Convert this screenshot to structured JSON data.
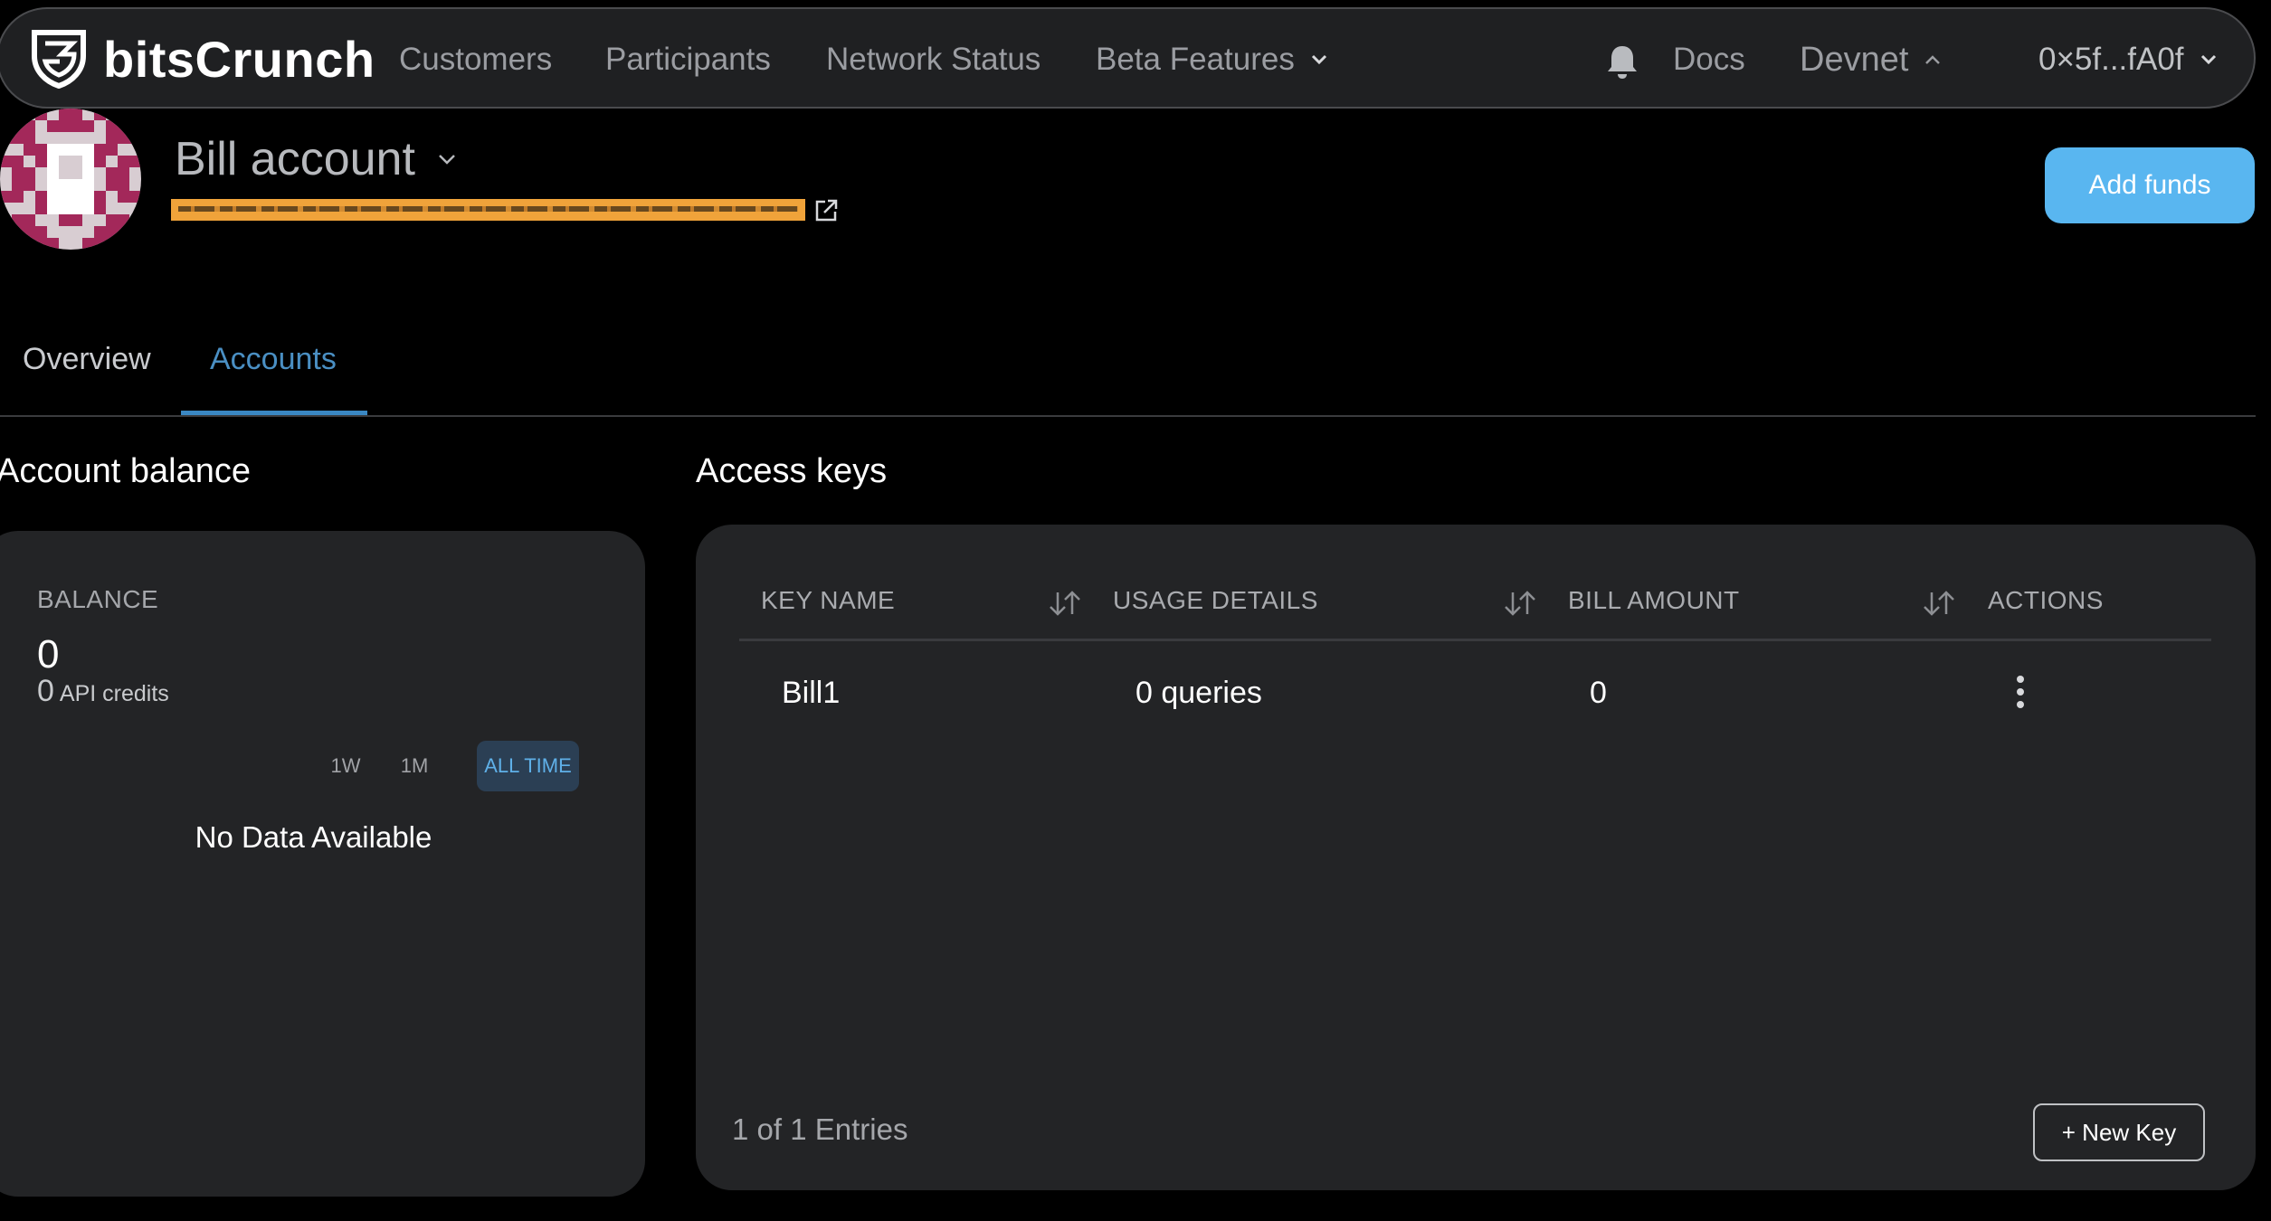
{
  "nav": {
    "brand": "bitsCrunch",
    "items": [
      {
        "label": "Customers"
      },
      {
        "label": "Participants"
      },
      {
        "label": "Network Status"
      },
      {
        "label": "Beta Features"
      }
    ],
    "docs": "Docs",
    "network": "Devnet",
    "wallet": "0×5f...fA0f"
  },
  "account": {
    "title": "Bill account",
    "add_funds": "Add funds"
  },
  "tabs": [
    {
      "label": "Overview",
      "active": false
    },
    {
      "label": "Accounts",
      "active": true
    }
  ],
  "balance": {
    "section_title": "Account balance",
    "label": "BALANCE",
    "value": "0",
    "credits_value": "0",
    "credits_label": "API credits",
    "ranges": [
      "1W",
      "1M",
      "ALL TIME"
    ],
    "selected_range": "ALL TIME",
    "empty": "No Data Available"
  },
  "keys": {
    "section_title": "Access keys",
    "columns": [
      "KEY NAME",
      "USAGE DETAILS",
      "BILL AMOUNT",
      "ACTIONS"
    ],
    "rows": [
      {
        "name": "Bill1",
        "usage": "0 queries",
        "bill": "0"
      }
    ],
    "entries": "1 of 1 Entries",
    "new_key": "+ New Key"
  },
  "colors": {
    "accent": "#59b6f0",
    "active_tab": "#4a8fc3",
    "redaction": "#f0a33a",
    "avatar_primary": "#a3285a"
  },
  "icons": [
    "bitscrunch-logo-icon",
    "chevron-down-icon",
    "bell-icon",
    "chevron-up-icon",
    "external-link-icon",
    "sort-icon",
    "kebab-menu-icon"
  ]
}
